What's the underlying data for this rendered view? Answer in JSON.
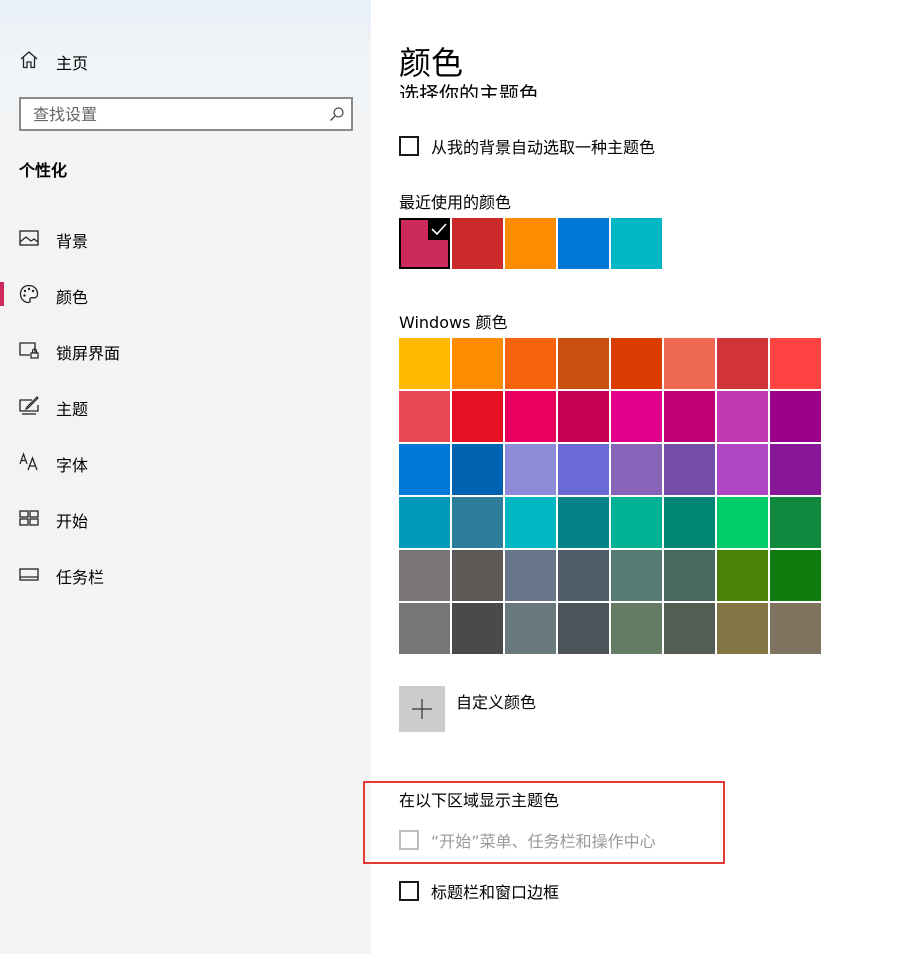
{
  "sidebar": {
    "home_label": "主页",
    "search_placeholder": "查找设置",
    "section_title": "个性化",
    "items": [
      {
        "label": "背景",
        "icon": "picture-icon"
      },
      {
        "label": "颜色",
        "icon": "palette-icon",
        "active": true
      },
      {
        "label": "锁屏界面",
        "icon": "lock-screen-icon"
      },
      {
        "label": "主题",
        "icon": "theme-icon"
      },
      {
        "label": "字体",
        "icon": "font-icon"
      },
      {
        "label": "开始",
        "icon": "start-icon"
      },
      {
        "label": "任务栏",
        "icon": "taskbar-icon"
      }
    ],
    "accent_color": "#cc2a5b"
  },
  "main": {
    "title": "颜色",
    "subtitle": "选择你的主题色",
    "auto_pick_label": "从我的背景自动选取一种主题色",
    "recent_label": "最近使用的颜色",
    "recent_colors": [
      "#cc2a5b",
      "#cc2a2a",
      "#ff8c00",
      "#0078d7",
      "#00b7c3"
    ],
    "windows_colors_label": "Windows 颜色",
    "windows_colors": [
      [
        "#ffb900",
        "#ff8c00",
        "#f7630c",
        "#ca5010",
        "#da3b01",
        "#ef6950",
        "#d13438",
        "#ff4343"
      ],
      [
        "#e74856",
        "#e81123",
        "#ea005e",
        "#c30052",
        "#e3008c",
        "#bf0077",
        "#c239b3",
        "#9a0089"
      ],
      [
        "#0078d7",
        "#0063b1",
        "#8e8cd8",
        "#6b69d6",
        "#8764b8",
        "#744da9",
        "#b146c2",
        "#881798"
      ],
      [
        "#0099bc",
        "#2d7d9a",
        "#00b7c3",
        "#038387",
        "#00b294",
        "#018574",
        "#00cc6a",
        "#10893e"
      ],
      [
        "#7a7574",
        "#5d5a58",
        "#68768a",
        "#515c6b",
        "#567c73",
        "#486860",
        "#498205",
        "#107c10"
      ],
      [
        "#767676",
        "#4c4a48",
        "#69797e",
        "#4a5459",
        "#647c64",
        "#525e54",
        "#847545",
        "#7e735f"
      ]
    ],
    "custom_color_label": "自定义颜色",
    "show_accent_label": "在以下区域显示主题色",
    "start_taskbar_label": "“开始”菜单、任务栏和操作中心",
    "title_bars_label": "标题栏和窗口边框"
  }
}
